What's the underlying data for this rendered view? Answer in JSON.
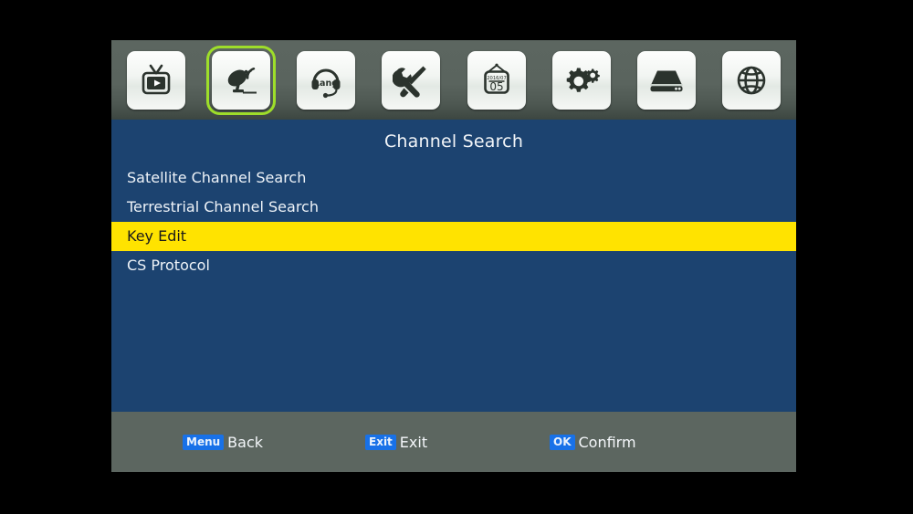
{
  "iconbar": {
    "items": [
      {
        "name": "tv-icon",
        "label": "TV / Program",
        "selected": false
      },
      {
        "name": "satellite-dish-icon",
        "label": "Channel Search",
        "selected": true
      },
      {
        "name": "headset-lang-icon",
        "label": "Lang",
        "selected": false
      },
      {
        "name": "tools-icon",
        "label": "System Setup",
        "selected": false
      },
      {
        "name": "calendar-icon",
        "label": "Timer",
        "selected": false
      },
      {
        "name": "gear-icon",
        "label": "Settings",
        "selected": false
      },
      {
        "name": "hard-disk-icon",
        "label": "Storage",
        "selected": false
      },
      {
        "name": "globe-icon",
        "label": "Network",
        "selected": false
      }
    ],
    "calendar_year_month": "2016/07",
    "calendar_day": "05",
    "headset_text": "Lang",
    "selected_outline_color": "#9ede2a"
  },
  "content": {
    "title": "Channel Search",
    "background_color": "#1c4370",
    "highlight_color": "#ffe300",
    "menu_items": [
      {
        "label": "Satellite Channel Search",
        "selected": false
      },
      {
        "label": "Terrestrial Channel Search",
        "selected": false
      },
      {
        "label": "Key Edit",
        "selected": true
      },
      {
        "label": "CS Protocol",
        "selected": false
      }
    ]
  },
  "footer": {
    "background_color": "#5c6660",
    "key_badge_color": "#1871e8",
    "hints": [
      {
        "key": "Menu",
        "label": "Back"
      },
      {
        "key": "Exit",
        "label": "Exit"
      },
      {
        "key": "OK",
        "label": "Confirm"
      }
    ]
  }
}
